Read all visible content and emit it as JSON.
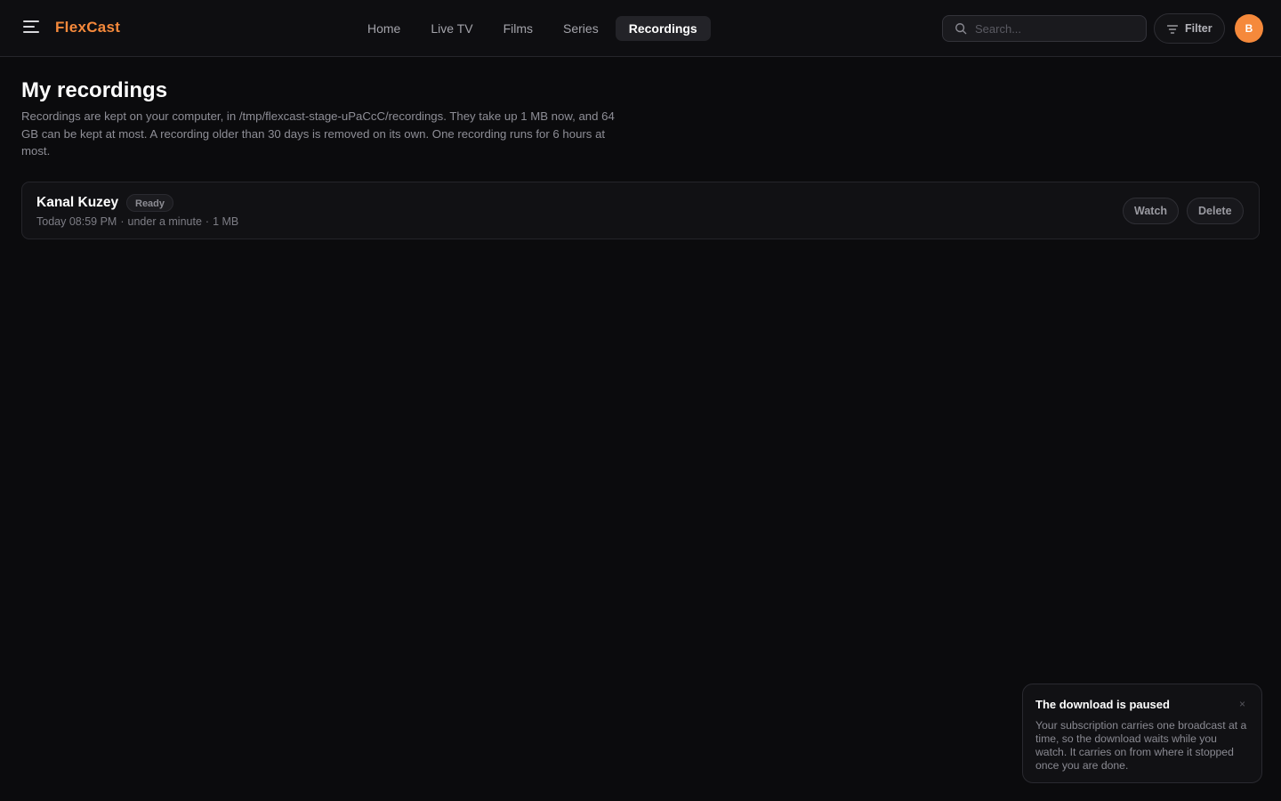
{
  "colors": {
    "accent": "#f5893b",
    "avatar_bg": "#f5893b",
    "background": "#0b0b0d"
  },
  "header": {
    "menu_icon": "hamburger-menu-icon",
    "brand": "FlexCast",
    "tabs": [
      {
        "label": "Home",
        "active": false
      },
      {
        "label": "Live TV",
        "active": false
      },
      {
        "label": "Films",
        "active": false
      },
      {
        "label": "Series",
        "active": false
      },
      {
        "label": "Recordings",
        "active": true
      }
    ],
    "search": {
      "icon": "search-icon",
      "placeholder": "Search...",
      "value": ""
    },
    "filter": {
      "icon": "filter-icon",
      "label": "Filter"
    },
    "avatar_initial": "B"
  },
  "main": {
    "title": "My recordings",
    "description": "Recordings are kept on your computer, in /tmp/flexcast-stage-uPaCcC/recordings. They take up 1 MB now, and 64 GB can be kept at most. A recording older than 30 days is removed on its own. One recording runs for 6 hours at most.",
    "recordings": [
      {
        "title": "Kanal Kuzey",
        "status": "Ready",
        "date": "Today 08:59 PM",
        "duration": "under a minute",
        "size": "1 MB",
        "separator": "·",
        "watch_label": "Watch",
        "delete_label": "Delete"
      }
    ]
  },
  "toast": {
    "title": "The download is paused",
    "close_icon": "close-icon",
    "close_glyph": "×",
    "body": "Your subscription carries one broadcast at a time, so the download waits while you watch. It carries on from where it stopped once you are done."
  }
}
